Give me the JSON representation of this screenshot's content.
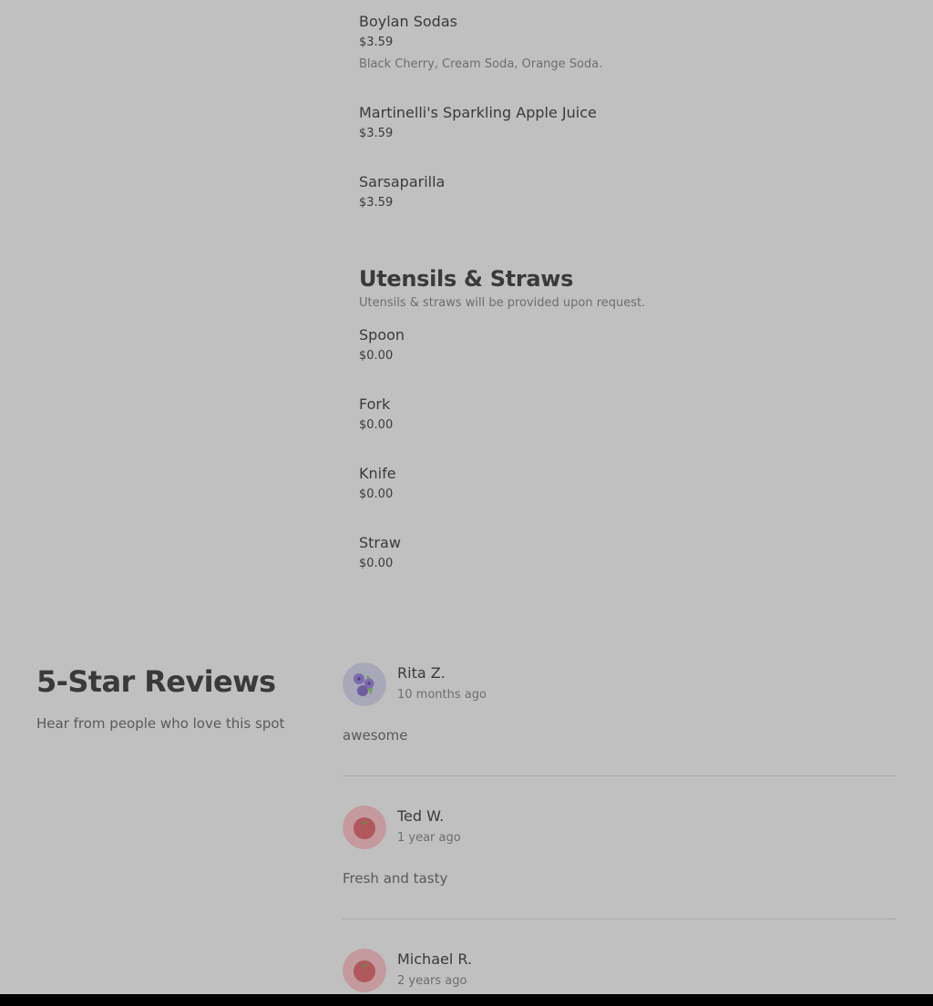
{
  "menu": {
    "drinks": [
      {
        "name": "Boylan Sodas",
        "price": "$3.59",
        "description": "Black Cherry, Cream Soda, Orange Soda."
      },
      {
        "name": "Martinelli's Sparkling Apple Juice",
        "price": "$3.59"
      },
      {
        "name": "Sarsaparilla",
        "price": "$3.59"
      }
    ],
    "utensils_section": {
      "title": "Utensils & Straws",
      "subtitle": "Utensils & straws will be provided upon request.",
      "items": [
        {
          "name": "Spoon",
          "price": "$0.00"
        },
        {
          "name": "Fork",
          "price": "$0.00"
        },
        {
          "name": "Knife",
          "price": "$0.00"
        },
        {
          "name": "Straw",
          "price": "$0.00"
        }
      ]
    }
  },
  "reviews": {
    "heading": "5-Star Reviews",
    "subheading": "Hear from people who love this spot",
    "items": [
      {
        "name": "Rita Z.",
        "time": "10 months ago",
        "text": "awesome",
        "avatar": "blueberry-icon"
      },
      {
        "name": "Ted W.",
        "time": "1 year ago",
        "text": "Fresh and tasty",
        "avatar": "tomato-icon"
      },
      {
        "name": "Michael R.",
        "time": "2 years ago",
        "avatar": "tomato-icon"
      }
    ]
  },
  "colors": {
    "background": "#c0c0c0",
    "text": "#3a3a3a",
    "muted": "#6e6e6e",
    "blueberry_avatar_bg": "#a8a8b8",
    "tomato_avatar_bg": "#c49a9e",
    "tomato": "#b0585c",
    "blueberry": "#6f5e9e",
    "leaf": "#72a05a"
  }
}
